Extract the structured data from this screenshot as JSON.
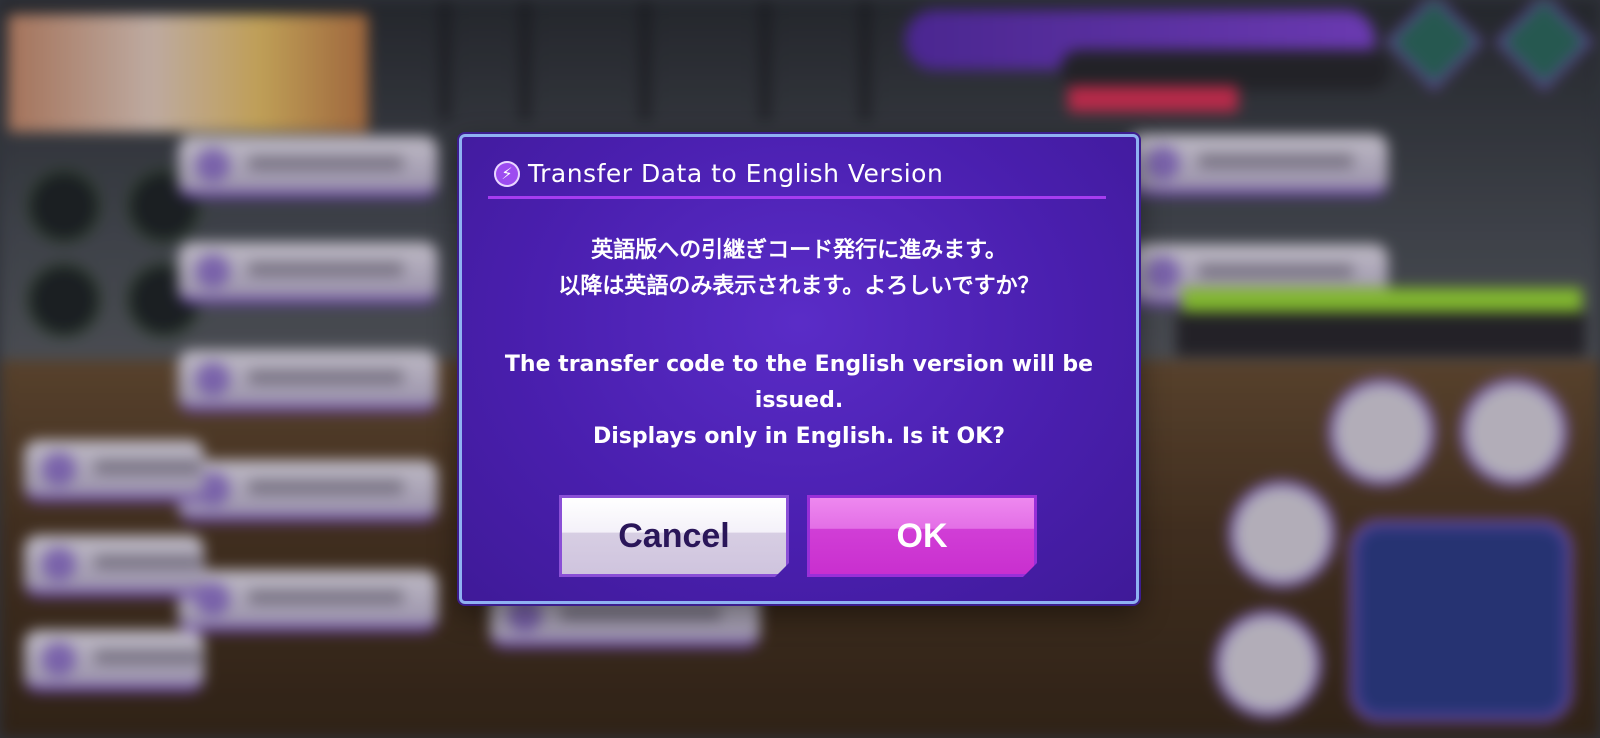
{
  "dialog": {
    "title": "Transfer Data to English Version",
    "title_icon": "lightning-bolt-icon",
    "message_ja": [
      "英語版への引継ぎコード発行に進みます。",
      "以降は英語のみ表示されます。よろしいですか？"
    ],
    "message_en": [
      "The transfer code to the English version will be",
      "issued.",
      "Displays only in English. Is it OK?"
    ],
    "buttons": {
      "cancel_label": "Cancel",
      "ok_label": "OK"
    }
  },
  "colors": {
    "dialog_bg": "#4a1faf",
    "dialog_border": "#8fb2f2",
    "title_rule": "#a63cf0",
    "ok_button": "#d13ed6",
    "cancel_button": "#f4f1f9"
  }
}
